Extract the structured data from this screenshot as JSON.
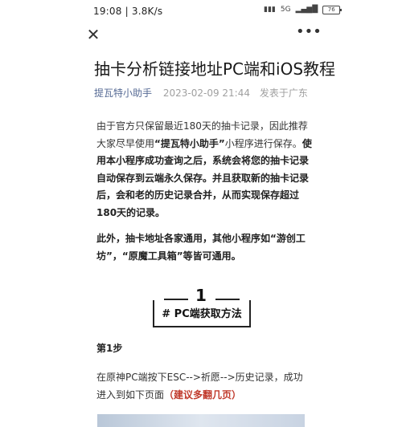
{
  "status_bar": {
    "time_speed": "19:08 | 3.8K/s",
    "network": "5G",
    "battery": "76"
  },
  "nav": {
    "close_icon": "close-icon",
    "more_icon": "more-dots-icon"
  },
  "article": {
    "title": "抽卡分析链接地址PC端和iOS教程",
    "author": "提瓦特小助手",
    "date": "2023-02-09 21:44",
    "location": "发表于广东",
    "p1_a": "由于官方只保留最近180天的抽卡记录，因此推荐大家尽早使用",
    "p1_b": "“提瓦特小助手”",
    "p1_c": "小程序进行保存。",
    "p1_d": "使用本小程序成功查询之后，系统会将您的抽卡记录自动保存到云端永久保存。并且获取新的抽卡记录后，会和老的历史记录合并，从而实现保存超过180天的记录。",
    "p2": "此外，抽卡地址各家通用，其他小程序如“游创工坊”，“原魔工具箱”等皆可通用。",
    "section_number": "1",
    "section_title": "# PC端获取方法",
    "step_label": "第1步",
    "p3_a": "在原神PC端按下ESC-->祈愿-->历史记录，成功进入到如下页面",
    "p3_b": "（建议多翻几页）"
  }
}
